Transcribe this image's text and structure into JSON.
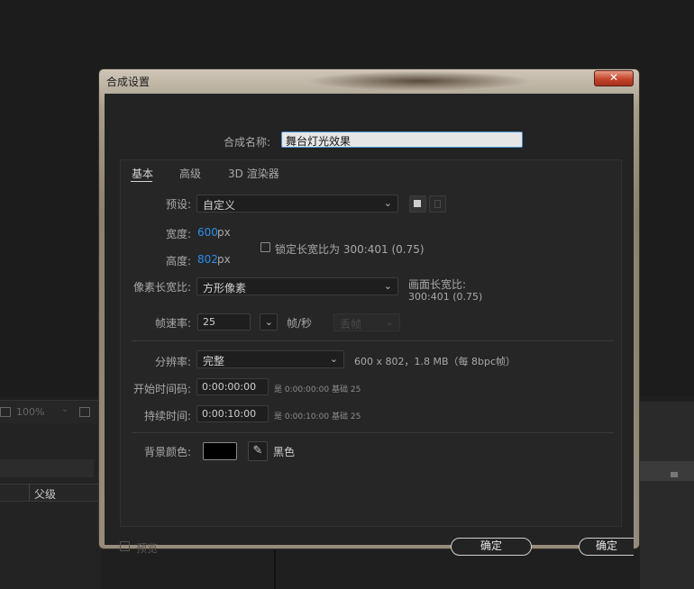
{
  "background": {
    "zoom": "100%",
    "parent_column": "父级"
  },
  "dialog": {
    "title": "合成设置",
    "close_label": "✕",
    "name_label": "合成名称:",
    "name_value": "舞台灯光效果",
    "tabs": [
      "基本",
      "高级",
      "3D 渲染器"
    ],
    "preset_label": "预设:",
    "preset_value": "自定义",
    "width_label": "宽度:",
    "width_value": "600",
    "height_label": "高度:",
    "height_value": "802",
    "px_unit": "px",
    "lock_aspect_label": "锁定长宽比为 300:401 (0.75)",
    "pixel_aspect_label": "像素长宽比:",
    "pixel_aspect_value": "方形像素",
    "frame_aspect_label": "画面长宽比:",
    "frame_aspect_value": "300:401 (0.75)",
    "frame_rate_label": "帧速率:",
    "frame_rate_value": "25",
    "fps_unit": "帧/秒",
    "drop_frame_value": "丢帧",
    "resolution_label": "分辨率:",
    "resolution_value": "完整",
    "resolution_info": "600 x 802，1.8 MB（每 8bpc帧）",
    "start_tc_label": "开始时间码:",
    "start_tc_value": "0:00:00:00",
    "start_tc_info": "是 0:00:00:00",
    "start_tc_base": "基础 25",
    "duration_label": "持续时间:",
    "duration_value": "0:00:10:00",
    "duration_info": "是 0:00:10:00",
    "duration_base": "基础 25",
    "bg_color_label": "背景颜色:",
    "bg_color_name": "黑色",
    "bg_color_hex": "#000000",
    "preview_label": "预览",
    "ok_label": "确定",
    "ok2_label": "确定"
  },
  "colors": {
    "accent_value": "#2d8ceb",
    "close_button": "#c2452b"
  }
}
